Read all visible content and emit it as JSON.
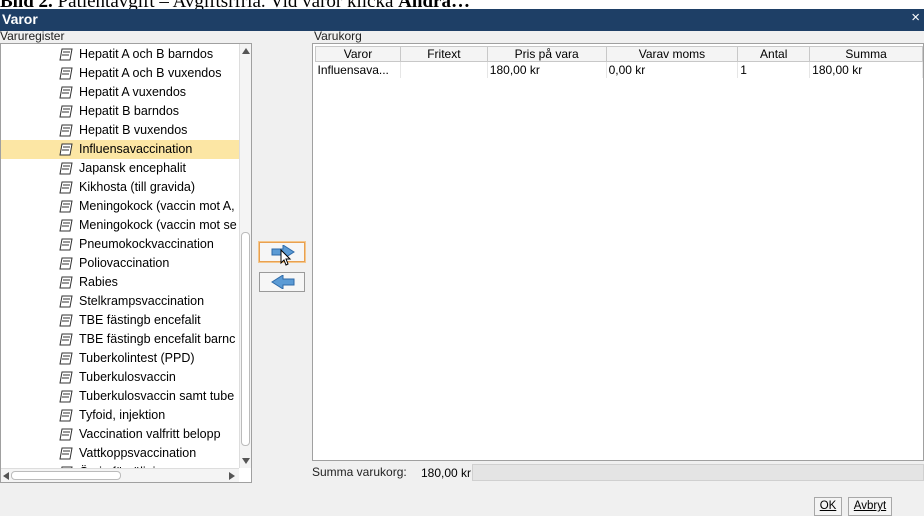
{
  "caption": {
    "prefix": "Bild 2.",
    "text": " Patientavgift – Avgiftsrfria. Vid varor klicka ",
    "bold_end": "Ändra…"
  },
  "window": {
    "title": "Varor",
    "close": "×"
  },
  "varuregister": {
    "label": "Varuregister",
    "items": [
      {
        "label": "Hepatit A och B barndos",
        "selected": false
      },
      {
        "label": "Hepatit A och B vuxendos",
        "selected": false
      },
      {
        "label": "Hepatit A vuxendos",
        "selected": false
      },
      {
        "label": "Hepatit B barndos",
        "selected": false
      },
      {
        "label": "Hepatit B vuxendos",
        "selected": false
      },
      {
        "label": "Influensavaccination",
        "selected": true
      },
      {
        "label": "Japansk encephalit",
        "selected": false
      },
      {
        "label": "Kikhosta (till gravida)",
        "selected": false
      },
      {
        "label": "Meningokock (vaccin mot A,",
        "selected": false
      },
      {
        "label": "Meningokock (vaccin mot se",
        "selected": false
      },
      {
        "label": "Pneumokockvaccination",
        "selected": false
      },
      {
        "label": "Poliovaccination",
        "selected": false
      },
      {
        "label": "Rabies",
        "selected": false
      },
      {
        "label": "Stelkrampsvaccination",
        "selected": false
      },
      {
        "label": "TBE fästingb encefalit",
        "selected": false
      },
      {
        "label": "TBE fästingb encefalit barnc",
        "selected": false
      },
      {
        "label": "Tuberkolintest (PPD)",
        "selected": false
      },
      {
        "label": "Tuberkulosvaccin",
        "selected": false
      },
      {
        "label": "Tuberkulosvaccin samt tube",
        "selected": false
      },
      {
        "label": "Tyfoid, injektion",
        "selected": false
      },
      {
        "label": "Vaccination valfritt belopp",
        "selected": false
      },
      {
        "label": "Vattkoppsvaccination",
        "selected": false
      },
      {
        "label": "Övrig försäljning",
        "selected": false
      }
    ]
  },
  "varukorg": {
    "label": "Varukorg",
    "columns": [
      "Varor",
      "Fritext",
      "Pris på vara",
      "Varav moms",
      "Antal",
      "Summa"
    ],
    "rows": [
      [
        "Influensava...",
        "",
        "180,00 kr",
        "0,00 kr",
        "1",
        "180,00 kr"
      ]
    ]
  },
  "summa": {
    "label": "Summa varukorg:",
    "value": "180,00 kr"
  },
  "buttons": {
    "ok": "OK",
    "avbryt": "Avbryt"
  },
  "colors": {
    "titlebar": "#1e3f66",
    "selection": "#fce6a4",
    "arrow": "#5b9bd5"
  }
}
